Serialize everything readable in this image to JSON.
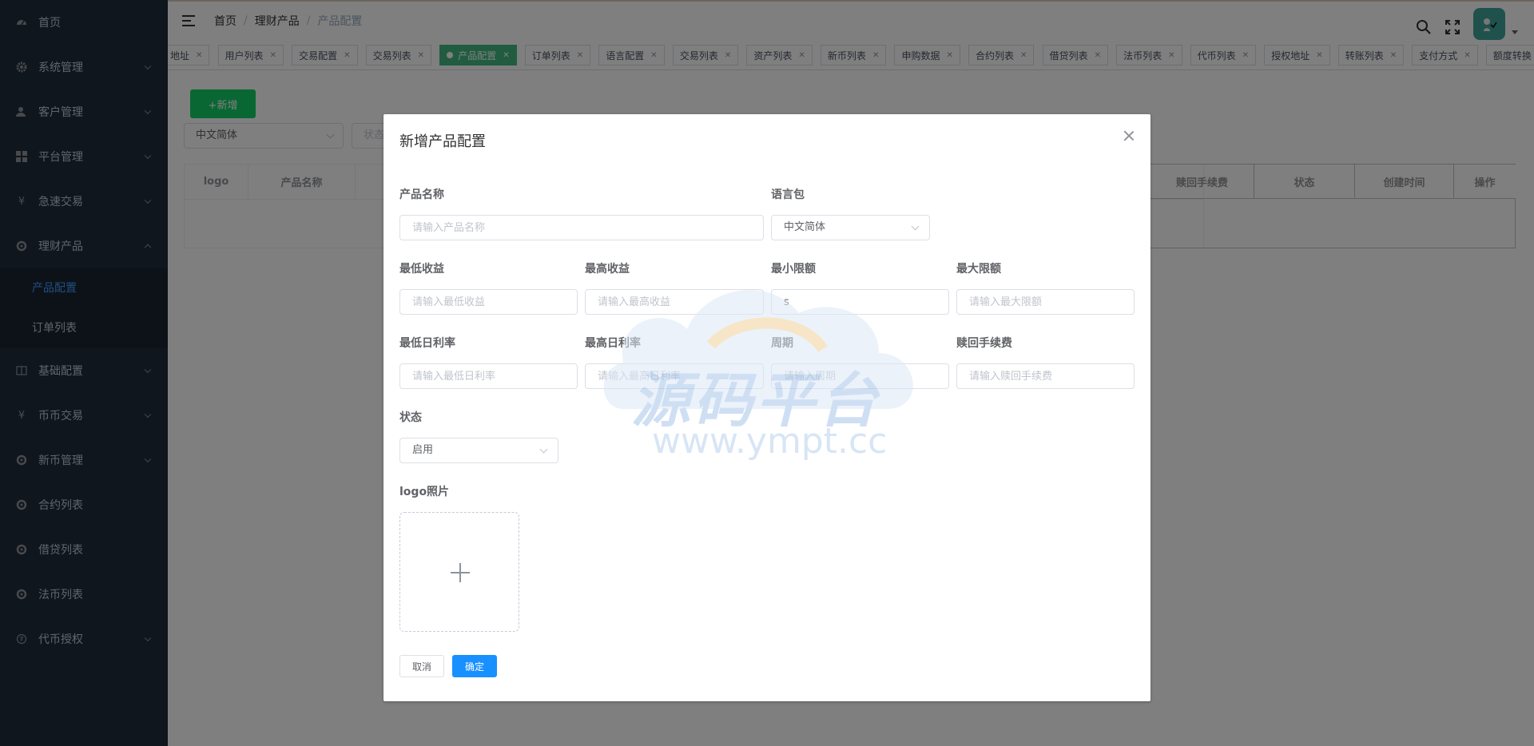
{
  "sidebar": {
    "items": [
      {
        "label": "首页",
        "icon": "dashboard-icon"
      },
      {
        "label": "系统管理",
        "icon": "gear-icon"
      },
      {
        "label": "客户管理",
        "icon": "user-icon"
      },
      {
        "label": "平台管理",
        "icon": "grid-icon"
      },
      {
        "label": "急速交易",
        "icon": "yen-icon"
      },
      {
        "label": "理财产品",
        "icon": "circle-icon",
        "expanded": true,
        "children": [
          {
            "label": "产品配置",
            "active": true
          },
          {
            "label": "订单列表"
          }
        ]
      },
      {
        "label": "基础配置",
        "icon": "book-icon"
      },
      {
        "label": "币币交易",
        "icon": "yen-icon"
      },
      {
        "label": "新币管理",
        "icon": "circle-icon"
      },
      {
        "label": "合约列表",
        "icon": "circle-icon"
      },
      {
        "label": "借贷列表",
        "icon": "circle-icon"
      },
      {
        "label": "法币列表",
        "icon": "circle-icon"
      },
      {
        "label": "代币授权",
        "icon": "coin-icon"
      }
    ]
  },
  "header": {
    "breadcrumb": [
      "首页",
      "理财产品",
      "产品配置"
    ],
    "icons": [
      "search-icon",
      "fullscreen-icon",
      "avatar"
    ]
  },
  "tags": [
    {
      "label": "地址"
    },
    {
      "label": "用户列表"
    },
    {
      "label": "交易配置"
    },
    {
      "label": "交易列表"
    },
    {
      "label": "产品配置",
      "active": true
    },
    {
      "label": "订单列表"
    },
    {
      "label": "语言配置"
    },
    {
      "label": "交易列表"
    },
    {
      "label": "资产列表"
    },
    {
      "label": "新币列表"
    },
    {
      "label": "申购数据"
    },
    {
      "label": "合约列表"
    },
    {
      "label": "借贷列表"
    },
    {
      "label": "法币列表"
    },
    {
      "label": "代币列表"
    },
    {
      "label": "授权地址"
    },
    {
      "label": "转账列表"
    },
    {
      "label": "支付方式"
    },
    {
      "label": "额度转换"
    }
  ],
  "main": {
    "add_button": "+新增",
    "language_filter": "中文简体",
    "status_filter_placeholder": "状态",
    "table_headers": [
      "logo",
      "产品名称",
      "赎回手续费",
      "状态",
      "创建时间",
      "操作"
    ]
  },
  "dialog": {
    "title": "新增产品配置",
    "fields": {
      "name": {
        "label": "产品名称",
        "placeholder": "请输入产品名称",
        "value": ""
      },
      "language": {
        "label": "语言包",
        "value": "中文简体"
      },
      "min_yield": {
        "label": "最低收益",
        "placeholder": "请输入最低收益",
        "value": ""
      },
      "max_yield": {
        "label": "最高收益",
        "placeholder": "请输入最高收益",
        "value": ""
      },
      "min_limit": {
        "label": "最小限额",
        "placeholder": "",
        "value": "s"
      },
      "max_limit": {
        "label": "最大限额",
        "placeholder": "请输入最大限额",
        "value": ""
      },
      "min_daily_rate": {
        "label": "最低日利率",
        "placeholder": "请输入最低日利率",
        "value": ""
      },
      "max_daily_rate": {
        "label": "最高日利率",
        "placeholder": "请输入最高日利率",
        "value": ""
      },
      "period": {
        "label": "周期",
        "placeholder": "请输入周期",
        "value": ""
      },
      "redeem_fee": {
        "label": "赎回手续费",
        "placeholder": "请输入赎回手续费",
        "value": ""
      },
      "status": {
        "label": "状态",
        "value": "启用"
      },
      "logo": {
        "label": "logo照片"
      }
    },
    "cancel_label": "取消",
    "confirm_label": "确定"
  },
  "watermark": {
    "text": "源码平台",
    "url": "www.ympt.cc"
  },
  "colors": {
    "sidebar_bg": "#1f2d3d",
    "active_tag": "#42b983",
    "add_button": "#13ce66",
    "confirm_button": "#1890ff",
    "link_active": "#409eff"
  }
}
